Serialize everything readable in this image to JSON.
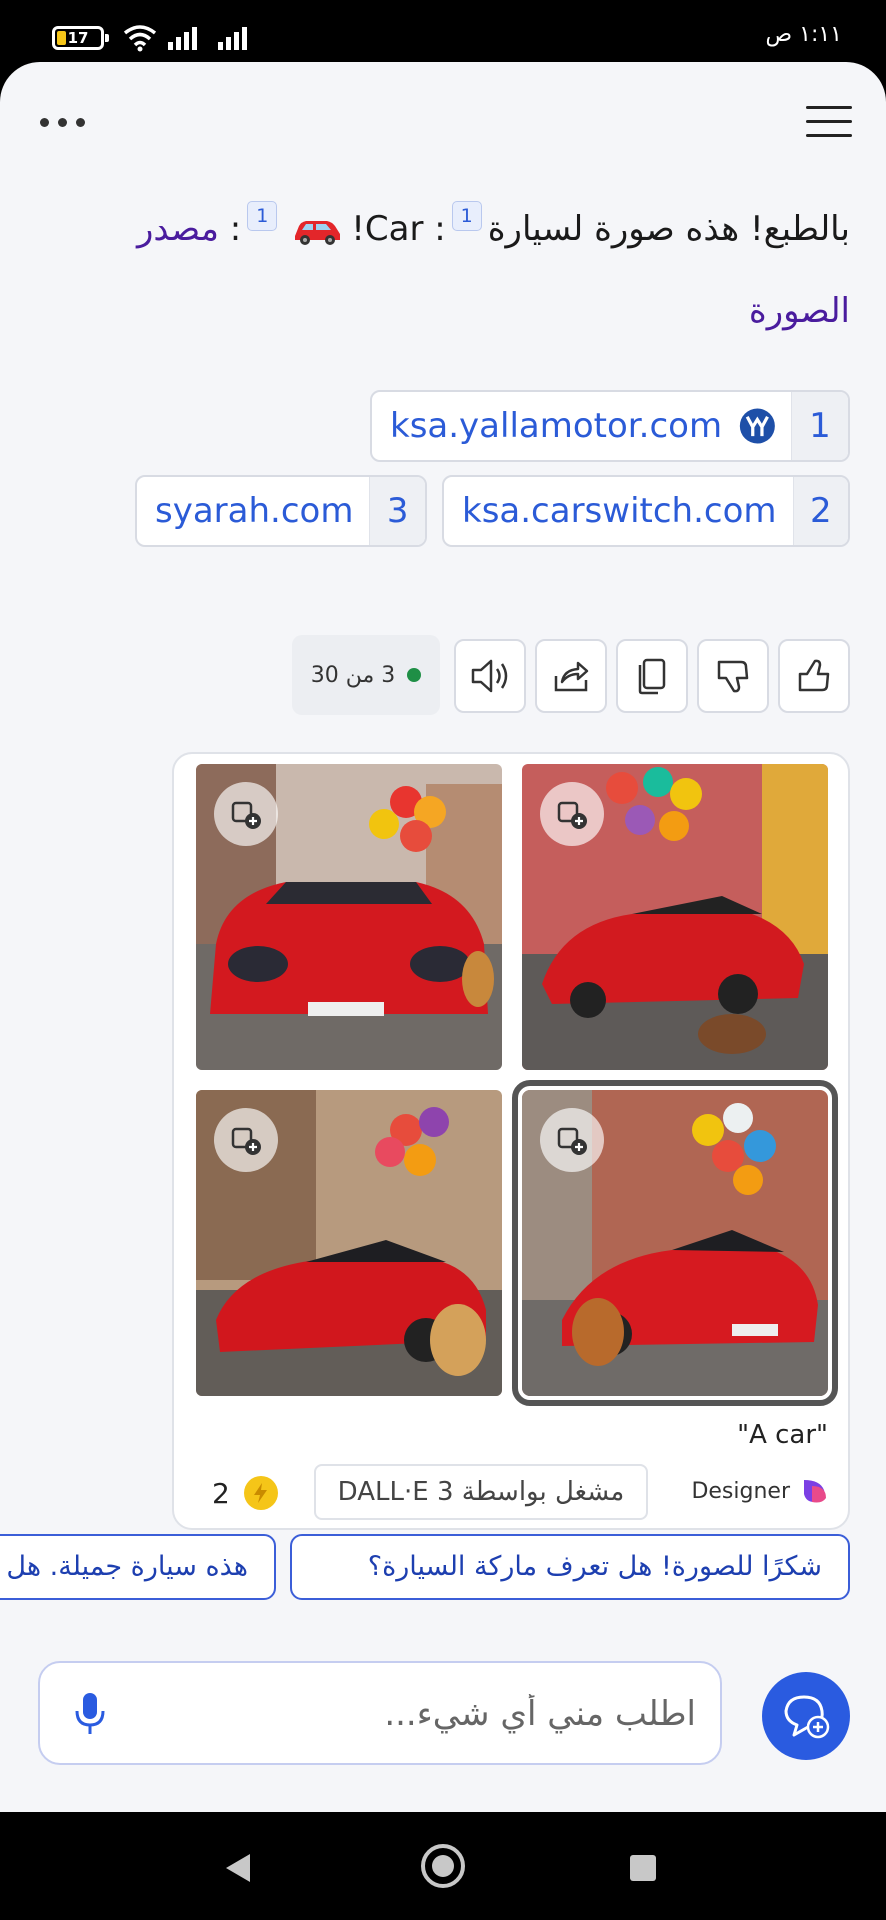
{
  "status_bar": {
    "time": "١:١١ ص",
    "battery": "17"
  },
  "header": {
    "more_icon": "more-dots-icon",
    "menu_icon": "hamburger-menu-icon"
  },
  "message": {
    "text_part1": "بالطبع! هذه صورة لسيارة",
    "ref1": "1",
    "text_part2": ": Car!",
    "ref2": "1",
    "text_part3": ": ",
    "source_label": "مصدر الصورة"
  },
  "sources": [
    {
      "number": "1",
      "domain": "ksa.yallamotor.com"
    },
    {
      "number": "2",
      "domain": "ksa.carswitch.com"
    },
    {
      "number": "3",
      "domain": "syarah.com"
    }
  ],
  "response_counter": "3 من 30",
  "actions": [
    "like-icon",
    "dislike-icon",
    "copy-icon",
    "share-icon",
    "speaker-icon"
  ],
  "image_card": {
    "prompt": "\"A car\"",
    "designer_label": "Designer",
    "powered_by": "مشغل بواسطة DALL·E 3",
    "boosts": "2",
    "accent": "#2a5be0"
  },
  "suggestions": [
    "شكرًا للصورة! هل تعرف ماركة السيارة؟",
    "هذه سيارة جميلة. هل يمكنك رسم سيارة أخرى؟"
  ],
  "composer": {
    "placeholder": "اطلب مني أي شيء..."
  }
}
